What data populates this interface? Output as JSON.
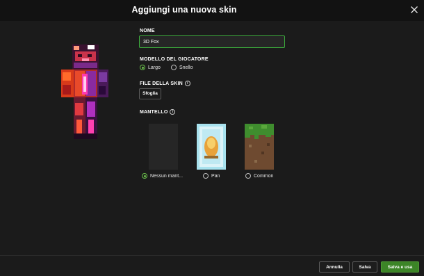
{
  "dialog": {
    "title": "Aggiungi una nuova skin"
  },
  "form": {
    "name_label": "NOME",
    "name_value": "3D Fox",
    "model_label": "MODELLO DEL GIOCATORE",
    "model_options": [
      {
        "label": "Largo",
        "selected": true
      },
      {
        "label": "Snello",
        "selected": false
      }
    ],
    "file_label": "FILE DELLA SKIN",
    "browse_label": "Sfoglia",
    "cape_label": "MANTELLO",
    "capes": [
      {
        "label": "Nessun mant...",
        "selected": true
      },
      {
        "label": "Pan",
        "selected": false
      },
      {
        "label": "Common",
        "selected": false
      }
    ]
  },
  "footer": {
    "cancel_label": "Annulla",
    "save_label": "Salva",
    "save_use_label": "Salva e usa"
  },
  "colors": {
    "accent": "#3c8527",
    "focus_border": "#3cac3c",
    "background": "#1b1b1b",
    "header": "#121212"
  }
}
